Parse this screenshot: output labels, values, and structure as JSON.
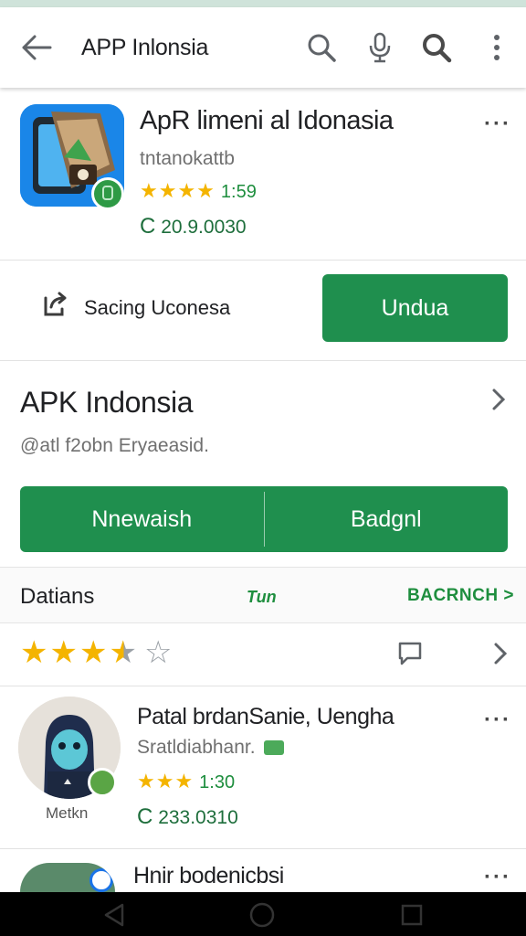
{
  "appbar": {
    "title": "APP Inlonsia"
  },
  "app_card": {
    "title": "ApR limeni al Idonasia",
    "developer": "tntanokattb",
    "rating": "1:59",
    "rating_stars": 4,
    "downloads": "20.9.0030"
  },
  "actions": {
    "share_label": "Sacing Uconesa",
    "install_label": "Undua"
  },
  "section": {
    "title": "APK Indonsia",
    "subtitle": "@atl f2obn Eryaeasid.",
    "left_button": "Nnewaish",
    "right_button": "Badgnl"
  },
  "tabs": {
    "details": "Datians",
    "middle": "Tun",
    "more": "BACRNCH >"
  },
  "rating_row": {
    "value": 3.5,
    "max": 5
  },
  "review": {
    "name": "Patal brdanSanie, Uengha",
    "subtitle": "Sratldiabhanr.",
    "rating": "1:30",
    "rating_stars": 3,
    "count": "233.0310",
    "avatar_label": "Metkn"
  },
  "partial_item": {
    "title": "Hnir bodenicbsi"
  },
  "colors": {
    "accent": "#1f8f4e",
    "star": "#f4b400",
    "text_green": "#1e8e3e"
  },
  "icons": [
    "back-arrow-icon",
    "search-icon",
    "mic-icon",
    "search-icon-bold",
    "overflow-menu-icon",
    "share-icon",
    "chevron-right-icon",
    "comment-icon",
    "nav-back-icon",
    "nav-home-icon",
    "nav-recents-icon"
  ]
}
